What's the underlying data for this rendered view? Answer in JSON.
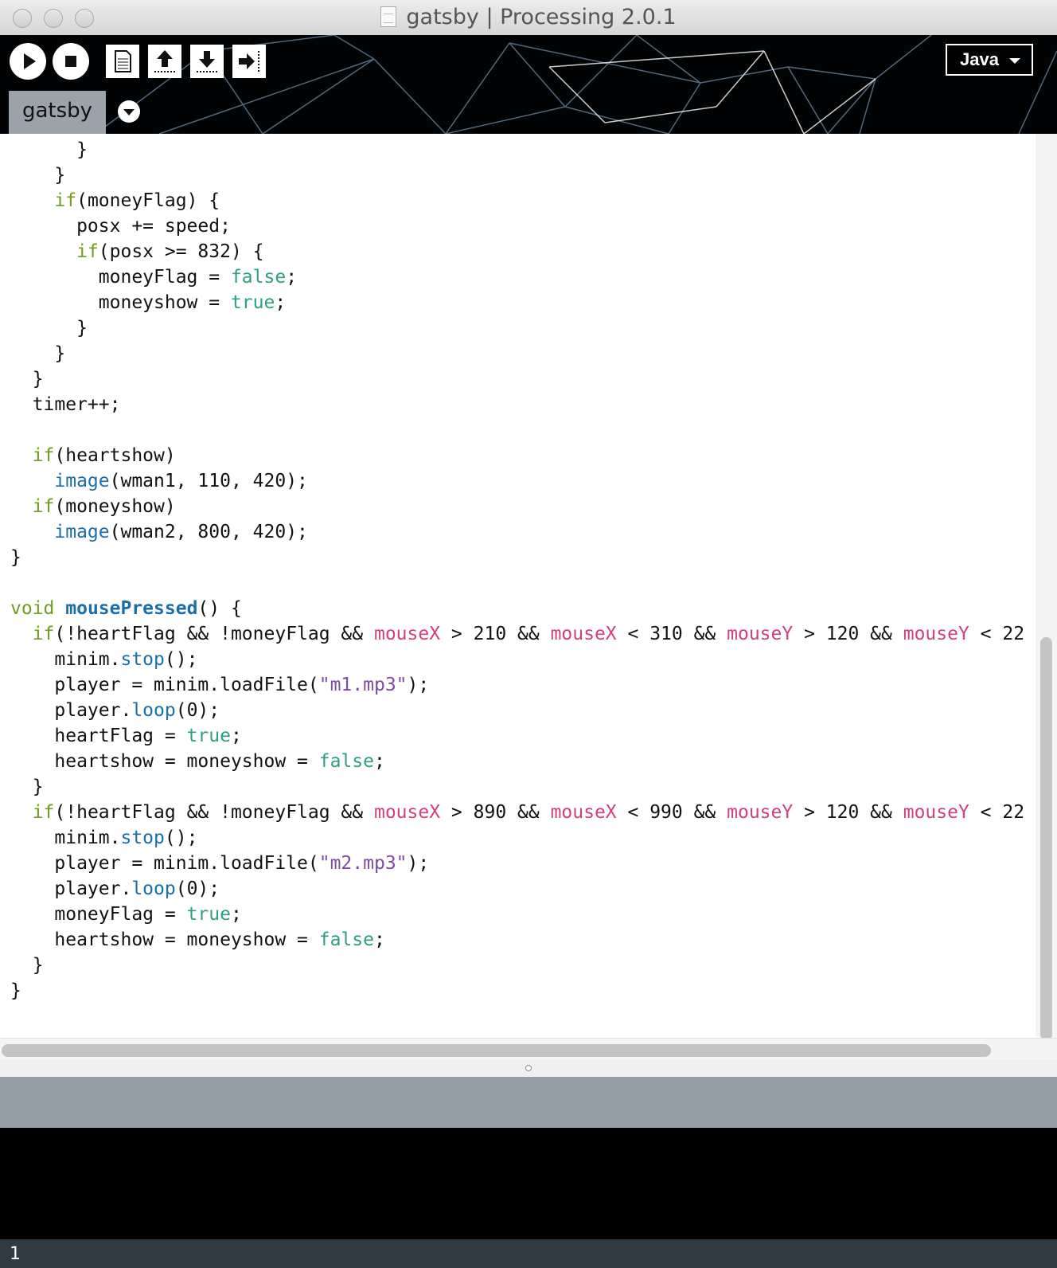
{
  "window": {
    "title": "gatsby | Processing 2.0.1"
  },
  "toolbar": {
    "buttons": [
      {
        "name": "run",
        "icon": "play-icon"
      },
      {
        "name": "stop",
        "icon": "stop-icon"
      },
      {
        "name": "new",
        "icon": "new-file-icon"
      },
      {
        "name": "open",
        "icon": "open-upload-icon"
      },
      {
        "name": "save",
        "icon": "save-download-icon"
      },
      {
        "name": "export",
        "icon": "export-arrow-icon"
      }
    ],
    "mode": "Java"
  },
  "tabs": [
    {
      "label": "gatsby",
      "active": true
    }
  ],
  "editor": {
    "lines": [
      "      }",
      "    }",
      "    if(moneyFlag) {",
      "      posx += speed;",
      "      if(posx >= 832) {",
      "        moneyFlag = false;",
      "        moneyshow = true;",
      "      }",
      "    }",
      "  }",
      "  timer++;",
      "",
      "  if(heartshow)",
      "    image(wman1, 110, 420);",
      "  if(moneyshow)",
      "    image(wman2, 800, 420);",
      "}",
      "",
      "void mousePressed() {",
      "  if(!heartFlag && !moneyFlag && mouseX > 210 && mouseX < 310 && mouseY > 120 && mouseY < 22",
      "    minim.stop();",
      "    player = minim.loadFile(\"m1.mp3\");",
      "    player.loop(0);",
      "    heartFlag = true;",
      "    heartshow = moneyshow = false;",
      "  }",
      "  if(!heartFlag && !moneyFlag && mouseX > 890 && mouseX < 990 && mouseY > 120 && mouseY < 22",
      "    minim.stop();",
      "    player = minim.loadFile(\"m2.mp3\");",
      "    player.loop(0);",
      "    moneyFlag = true;",
      "    heartshow = moneyshow = false;",
      "  }",
      "}"
    ]
  },
  "colors": {
    "keyword": "#6e9d1f",
    "literal": "#2f9e86",
    "function": "#1a6fa8",
    "builtin_var": "#d23f7a",
    "string": "#7d4aa6"
  },
  "status": {
    "line_number": "1"
  }
}
